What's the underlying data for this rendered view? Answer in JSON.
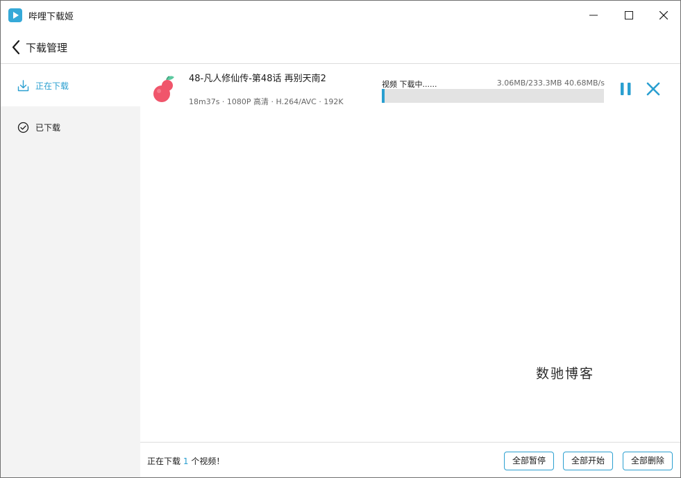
{
  "app": {
    "title": "哔哩下载姬"
  },
  "header": {
    "title": "下载管理"
  },
  "sidebar": {
    "items": [
      {
        "label": "正在下载",
        "icon": "download-icon",
        "active": true
      },
      {
        "label": "已下载",
        "icon": "check-circle-icon",
        "active": false
      }
    ]
  },
  "task": {
    "title": "48-凡人修仙传-第48话 再别天南2",
    "meta": "18m37s · 1080P 高清 · H.264/AVC · 192K",
    "status": "视频 下载中......",
    "size": "3.06MB/233.3MB 40.68MB/s",
    "progress": 0.013
  },
  "watermark": "数驰博客",
  "footer": {
    "prefix": "正在下载",
    "count": "1",
    "suffix": "个视频！",
    "buttons": {
      "pause_all": "全部暂停",
      "start_all": "全部开始",
      "delete_all": "全部删除"
    }
  },
  "colors": {
    "accent": "#2a9fd0",
    "progress_track": "#e3e3e3",
    "sidebar_bg": "#f3f3f3"
  }
}
